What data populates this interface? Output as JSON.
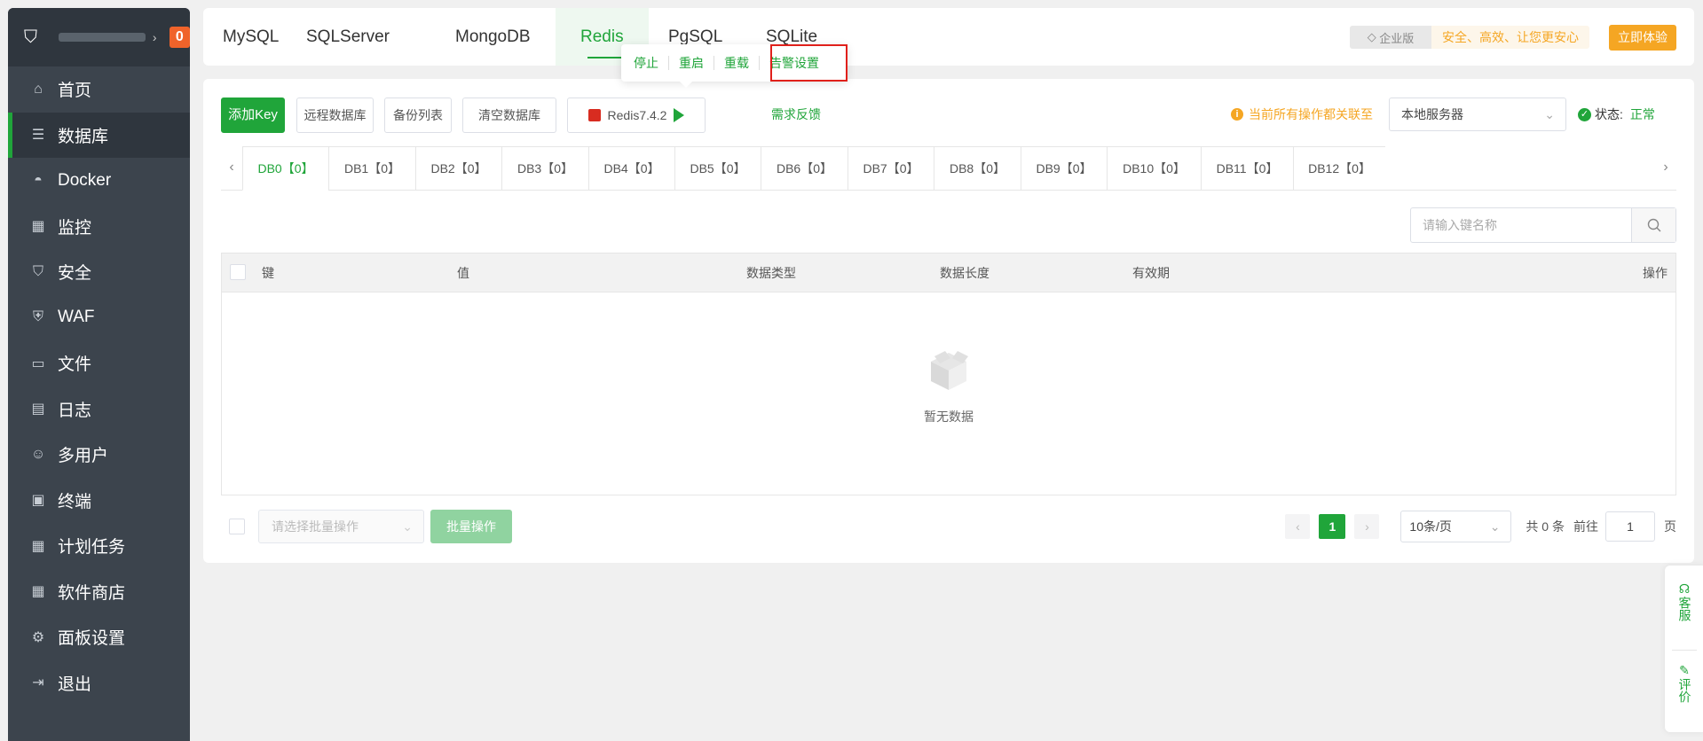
{
  "sidebar": {
    "badge": "0",
    "items": [
      {
        "label": "首页",
        "icon": "home-icon",
        "glyph": "⌂"
      },
      {
        "label": "数据库",
        "icon": "database-icon",
        "glyph": "☰"
      },
      {
        "label": "Docker",
        "icon": "docker-icon",
        "glyph": "◓"
      },
      {
        "label": "监控",
        "icon": "monitor-icon",
        "glyph": "▦"
      },
      {
        "label": "安全",
        "icon": "shield-icon",
        "glyph": "⛉"
      },
      {
        "label": "WAF",
        "icon": "waf-icon",
        "glyph": "⛨"
      },
      {
        "label": "文件",
        "icon": "folder-icon",
        "glyph": "▭"
      },
      {
        "label": "日志",
        "icon": "log-icon",
        "glyph": "▤"
      },
      {
        "label": "多用户",
        "icon": "users-icon",
        "glyph": "☺"
      },
      {
        "label": "终端",
        "icon": "terminal-icon",
        "glyph": "▣"
      },
      {
        "label": "计划任务",
        "icon": "calendar-icon",
        "glyph": "▦"
      },
      {
        "label": "软件商店",
        "icon": "apps-icon",
        "glyph": "▦"
      },
      {
        "label": "面板设置",
        "icon": "gear-icon",
        "glyph": "⚙"
      },
      {
        "label": "退出",
        "icon": "logout-icon",
        "glyph": "⇥"
      }
    ]
  },
  "topbar": {
    "tabs": [
      "MySQL",
      "SQLServer",
      "MongoDB",
      "Redis",
      "PgSQL",
      "SQLite"
    ],
    "active_tab": "Redis",
    "promo_edition": "企业版",
    "promo_text": "安全、高效、让您更安心",
    "try_label": "立即体验"
  },
  "popover": {
    "items": [
      "停止",
      "重启",
      "重载",
      "告警设置"
    ]
  },
  "toolbar": {
    "add_key": "添加Key",
    "remote_db": "远程数据库",
    "backup_list": "备份列表",
    "clear_db": "清空数据库",
    "redis_version": "Redis7.4.2",
    "feedback": "需求反馈",
    "notice": "当前所有操作都关联至",
    "server": "本地服务器",
    "status_label": "状态:",
    "status_value": "正常"
  },
  "db_tabs": [
    "DB0【0】",
    "DB1【0】",
    "DB2【0】",
    "DB3【0】",
    "DB4【0】",
    "DB5【0】",
    "DB6【0】",
    "DB7【0】",
    "DB8【0】",
    "DB9【0】",
    "DB10【0】",
    "DB11【0】",
    "DB12【0】"
  ],
  "search": {
    "placeholder": "请输入键名称"
  },
  "table": {
    "columns": [
      "键",
      "值",
      "数据类型",
      "数据长度",
      "有效期",
      "操作"
    ],
    "empty_text": "暂无数据"
  },
  "footer": {
    "batch_placeholder": "请选择批量操作",
    "batch_button": "批量操作",
    "current_page": "1",
    "page_size": "10条/页",
    "total": "共 0 条",
    "goto_label": "前往",
    "goto_value": "1",
    "page_suffix": "页"
  },
  "float_panel": {
    "service": "客服",
    "review": "评价"
  },
  "colors": {
    "brand": "#20a53a",
    "sidebar": "#3c444d",
    "accent": "#f5a623",
    "highlight": "#e0201b"
  }
}
